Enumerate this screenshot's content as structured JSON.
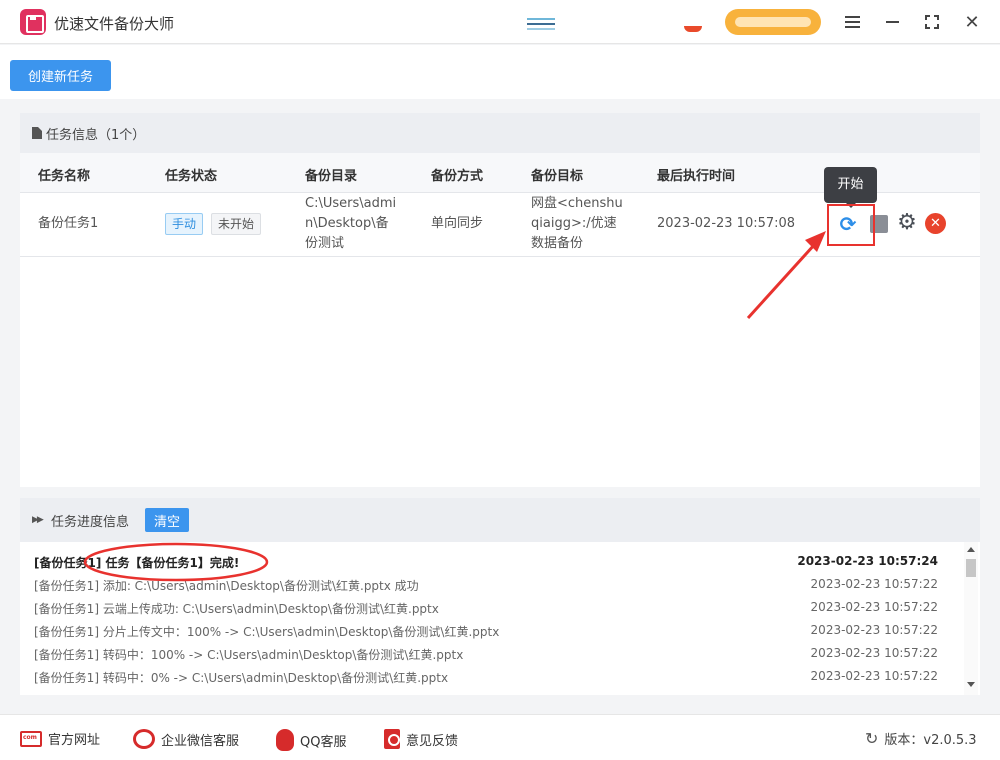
{
  "app": {
    "title": "优速文件备份大师"
  },
  "window_controls": {
    "menu_icon": "menu-icon",
    "minimize_icon": "minimize-icon",
    "maximize_icon": "maximize-icon",
    "close_icon": "close-icon",
    "close_glyph": "✕"
  },
  "toolbar": {
    "create_task_label": "创建新任务"
  },
  "task_panel": {
    "title": "任务信息（1个）",
    "columns": [
      "任务名称",
      "任务状态",
      "备份目录",
      "备份方式",
      "备份目标",
      "最后执行时间"
    ],
    "rows": [
      {
        "name": "备份任务1",
        "mode_tag": "手动",
        "status_tag": "未开始",
        "source_dir": [
          "C:\\Users\\admi",
          "n\\Desktop\\备",
          "份测试"
        ],
        "method": "单向同步",
        "target": [
          "网盘<chenshu",
          "qiaigg>:/优速",
          "数据备份"
        ],
        "last_run": "2023-02-23 10:57:08",
        "actions": {
          "start_glyph": "⟳",
          "gear_glyph": "⚙",
          "delete_glyph": "✕"
        }
      }
    ],
    "tooltip": "开始"
  },
  "progress_panel": {
    "title": "任务进度信息",
    "clear_label": "清空",
    "logs": [
      {
        "message": "[备份任务1] 任务【备份任务1】完成!",
        "time": "2023-02-23 10:57:24",
        "bold": true
      },
      {
        "message": "[备份任务1] 添加:   C:\\Users\\admin\\Desktop\\备份测试\\红黄.pptx 成功",
        "time": "2023-02-23 10:57:22",
        "bold": false
      },
      {
        "message": "[备份任务1] 云端上传成功: C:\\Users\\admin\\Desktop\\备份测试\\红黄.pptx",
        "time": "2023-02-23 10:57:22",
        "bold": false
      },
      {
        "message": "[备份任务1] 分片上传文中：100% -> C:\\Users\\admin\\Desktop\\备份测试\\红黄.pptx",
        "time": "2023-02-23 10:57:22",
        "bold": false
      },
      {
        "message": "[备份任务1] 转码中：100% -> C:\\Users\\admin\\Desktop\\备份测试\\红黄.pptx",
        "time": "2023-02-23 10:57:22",
        "bold": false
      },
      {
        "message": "[备份任务1] 转码中：0% -> C:\\Users\\admin\\Desktop\\备份测试\\红黄.pptx",
        "time": "2023-02-23 10:57:22",
        "bold": false
      }
    ]
  },
  "footer": {
    "links": [
      "官方网址",
      "企业微信客服",
      "QQ客服",
      "意见反馈"
    ],
    "version": "版本：v2.0.5.3"
  },
  "colors": {
    "accent": "#3c95ee",
    "annotation": "#e8322e",
    "delete": "#e8432c"
  }
}
